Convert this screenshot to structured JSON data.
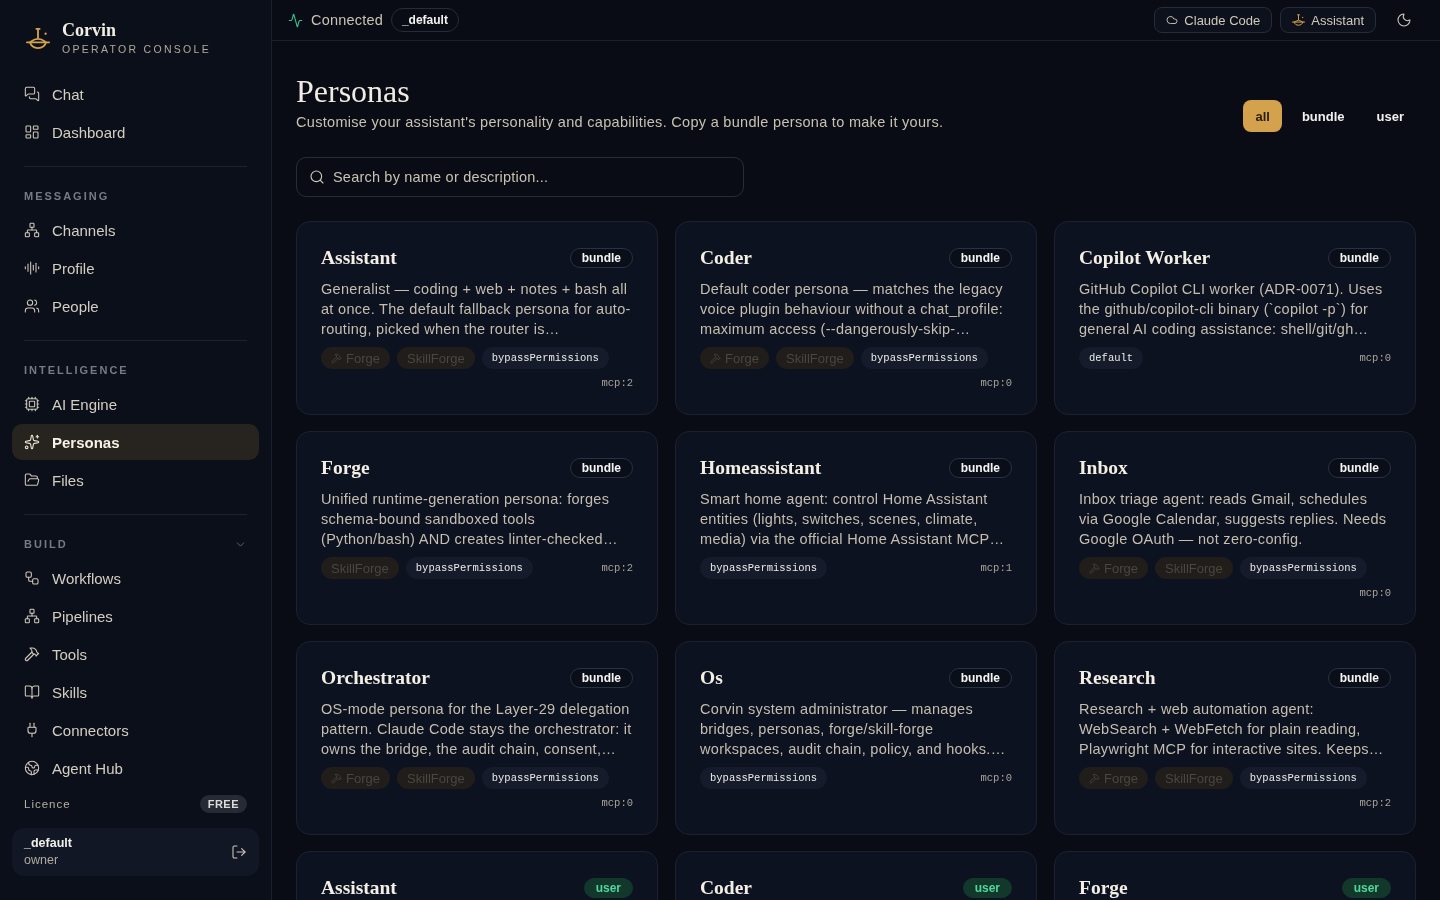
{
  "sidebar": {
    "brand": {
      "name": "Corvin",
      "tagline": "OPERATOR CONSOLE"
    },
    "pinned": [
      {
        "label": "Chat",
        "selected": false
      },
      {
        "label": "Dashboard",
        "selected": false
      }
    ],
    "sections": [
      {
        "kind": "plain",
        "title": "MESSAGING",
        "items": [
          {
            "label": "Channels",
            "selected": false
          },
          {
            "label": "Profile",
            "selected": false
          },
          {
            "label": "People",
            "selected": false
          }
        ]
      },
      {
        "kind": "plain",
        "title": "INTELLIGENCE",
        "items": [
          {
            "label": "AI Engine",
            "selected": false
          },
          {
            "label": "Personas",
            "selected": true
          },
          {
            "label": "Files",
            "selected": false
          }
        ]
      },
      {
        "kind": "collapsible",
        "title": "BUILD",
        "expanded": true,
        "items": [
          {
            "label": "Workflows",
            "selected": false
          },
          {
            "label": "Pipelines",
            "selected": false
          },
          {
            "label": "Tools",
            "selected": false
          },
          {
            "label": "Skills",
            "selected": false
          },
          {
            "label": "Connectors",
            "selected": false
          },
          {
            "label": "Agent Hub",
            "selected": false
          }
        ]
      }
    ],
    "licence": {
      "label": "Licence",
      "plan": "FREE"
    },
    "user": {
      "name": "_default",
      "role": "owner"
    }
  },
  "topbar": {
    "status": {
      "label": "Connected",
      "connected": true
    },
    "workspace": "_default",
    "buttons": [
      {
        "label": "Claude Code"
      },
      {
        "label": "Assistant"
      }
    ]
  },
  "page": {
    "title": "Personas",
    "subtitle": "Customise your assistant's personality and capabilities. Copy a bundle persona to make it yours.",
    "filters": [
      {
        "label": "all",
        "selected": true
      },
      {
        "label": "bundle",
        "selected": false
      },
      {
        "label": "user",
        "selected": false
      }
    ],
    "search": {
      "placeholder": "Search by name or description..."
    }
  },
  "personas": [
    {
      "title": "Assistant",
      "badge": {
        "label": "bundle",
        "kind": "bundle"
      },
      "description": "Generalist — coding + web + notes + bash all at once. The default fallback persona for auto-routing, picked when the router is…",
      "tags": [
        {
          "label": "Forge",
          "kind": "forge",
          "enabled": false
        },
        {
          "label": "SkillForge",
          "kind": "skill",
          "enabled": false
        },
        {
          "label": "bypassPermissions",
          "kind": "mode",
          "enabled": true
        }
      ],
      "mcp": "mcp:2"
    },
    {
      "title": "Coder",
      "badge": {
        "label": "bundle",
        "kind": "bundle"
      },
      "description": "Default coder persona — matches the legacy voice plugin behaviour without a chat_profile: maximum access (--dangerously-skip-…",
      "tags": [
        {
          "label": "Forge",
          "kind": "forge",
          "enabled": false
        },
        {
          "label": "SkillForge",
          "kind": "skill",
          "enabled": false
        },
        {
          "label": "bypassPermissions",
          "kind": "mode",
          "enabled": true
        }
      ],
      "mcp": "mcp:0"
    },
    {
      "title": "Copilot Worker",
      "badge": {
        "label": "bundle",
        "kind": "bundle"
      },
      "description": "GitHub Copilot CLI worker (ADR-0071). Uses the github/copilot-cli binary (`copilot -p`) for general AI coding assistance: shell/git/gh…",
      "tags": [
        {
          "label": "default",
          "kind": "mode",
          "enabled": true
        }
      ],
      "mcp": "mcp:0"
    },
    {
      "title": "Forge",
      "badge": {
        "label": "bundle",
        "kind": "bundle"
      },
      "description": "Unified runtime-generation persona: forges schema-bound sandboxed tools (Python/bash) AND creates linter-checked…",
      "tags": [
        {
          "label": "SkillForge",
          "kind": "skill",
          "enabled": false
        },
        {
          "label": "bypassPermissions",
          "kind": "mode",
          "enabled": true
        }
      ],
      "mcp": "mcp:2"
    },
    {
      "title": "Homeassistant",
      "badge": {
        "label": "bundle",
        "kind": "bundle"
      },
      "description": "Smart home agent: control Home Assistant entities (lights, switches, scenes, climate, media) via the official Home Assistant MCP…",
      "tags": [
        {
          "label": "bypassPermissions",
          "kind": "mode",
          "enabled": true
        }
      ],
      "mcp": "mcp:1"
    },
    {
      "title": "Inbox",
      "badge": {
        "label": "bundle",
        "kind": "bundle"
      },
      "description": "Inbox triage agent: reads Gmail, schedules via Google Calendar, suggests replies. Needs Google OAuth — not zero-config.",
      "tags": [
        {
          "label": "Forge",
          "kind": "forge",
          "enabled": false
        },
        {
          "label": "SkillForge",
          "kind": "skill",
          "enabled": false
        },
        {
          "label": "bypassPermissions",
          "kind": "mode",
          "enabled": true
        }
      ],
      "mcp": "mcp:0"
    },
    {
      "title": "Orchestrator",
      "badge": {
        "label": "bundle",
        "kind": "bundle"
      },
      "description": "OS-mode persona for the Layer-29 delegation pattern. Claude Code stays the orchestrator: it owns the bridge, the audit chain, consent,…",
      "tags": [
        {
          "label": "Forge",
          "kind": "forge",
          "enabled": false
        },
        {
          "label": "SkillForge",
          "kind": "skill",
          "enabled": false
        },
        {
          "label": "bypassPermissions",
          "kind": "mode",
          "enabled": true
        }
      ],
      "mcp": "mcp:0"
    },
    {
      "title": "Os",
      "badge": {
        "label": "bundle",
        "kind": "bundle"
      },
      "description": "Corvin system administrator — manages bridges, personas, forge/skill-forge workspaces, audit chain, policy, and hooks.…",
      "tags": [
        {
          "label": "bypassPermissions",
          "kind": "mode",
          "enabled": true
        }
      ],
      "mcp": "mcp:0"
    },
    {
      "title": "Research",
      "badge": {
        "label": "bundle",
        "kind": "bundle"
      },
      "description": "Research + web automation agent: WebSearch + WebFetch for plain reading, Playwright MCP for interactive sites. Keeps…",
      "tags": [
        {
          "label": "Forge",
          "kind": "forge",
          "enabled": false
        },
        {
          "label": "SkillForge",
          "kind": "skill",
          "enabled": false
        },
        {
          "label": "bypassPermissions",
          "kind": "mode",
          "enabled": true
        }
      ],
      "mcp": "mcp:2"
    },
    {
      "title": "Assistant",
      "badge": {
        "label": "user",
        "kind": "user"
      }
    },
    {
      "title": "Coder",
      "badge": {
        "label": "user",
        "kind": "user"
      }
    },
    {
      "title": "Forge",
      "badge": {
        "label": "user",
        "kind": "user"
      }
    }
  ]
}
